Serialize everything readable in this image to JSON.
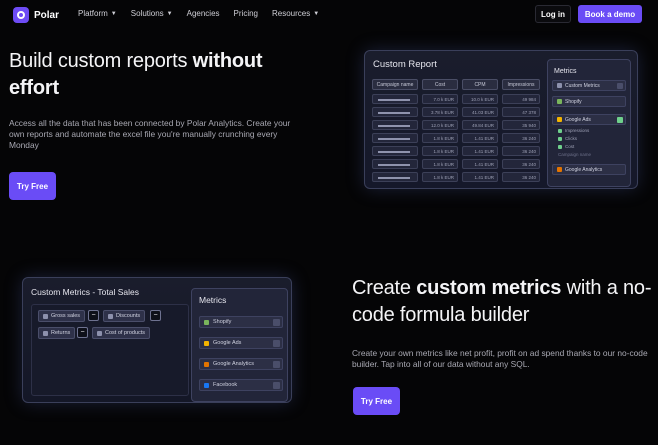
{
  "nav": {
    "logo": "Polar",
    "links": [
      "Platform",
      "Solutions",
      "Agencies",
      "Pricing",
      "Resources"
    ],
    "login": "Log in",
    "demo": "Book a demo"
  },
  "hero1": {
    "title_plain": "Build custom reports ",
    "title_bold": "without effort",
    "body": "Access all the data that has been connected by Polar Analytics. Create your own reports and automate the excel file you're manually crunching every Monday",
    "cta": "Try Free"
  },
  "report": {
    "title": "Custom Report",
    "headers": [
      "Campaign name",
      "Cost",
      "CPM",
      "Impressions"
    ],
    "rows": [
      [
        "7.0 k EUR",
        "10.0 k EUR",
        "49 984"
      ],
      [
        "3.78 k EUR",
        "41.03 EUR",
        "47 378"
      ],
      [
        "12.0 k EUR",
        "49.84 EUR",
        "35 940"
      ],
      [
        "1.8 k EUR",
        "1.41 EUR",
        "36 240"
      ],
      [
        "1.8 k EUR",
        "1.41 EUR",
        "36 240"
      ],
      [
        "1.8 k EUR",
        "1.41 EUR",
        "36 240"
      ],
      [
        "1.8 k EUR",
        "1.41 EUR",
        "36 240"
      ]
    ],
    "metrics_title": "Metrics",
    "metrics_items": [
      "Custom Metrics",
      "Shopify",
      "Google Ads",
      "Google Analytics"
    ],
    "google_ads_sub": [
      "Impressions",
      "Clicks",
      "Cost",
      "Campaign name"
    ]
  },
  "metrics_card": {
    "title": "Custom Metrics - Total Sales",
    "chips": [
      "Gross sales",
      "Discounts",
      "Returns",
      "Cost of products"
    ],
    "ops": [
      "−",
      "−",
      "−"
    ],
    "panel_title": "Metrics",
    "panel_items": [
      "Shopify",
      "Google Ads",
      "Google Analytics",
      "Facebook"
    ]
  },
  "hero2": {
    "title_plain1": "Create ",
    "title_bold": "custom metrics",
    "title_plain2": " with a no-code formula builder",
    "body": "Create your own metrics like net profit, profit on ad spend thanks to our no-code builder. Tap into all of our data without any SQL.",
    "cta": "Try Free"
  }
}
